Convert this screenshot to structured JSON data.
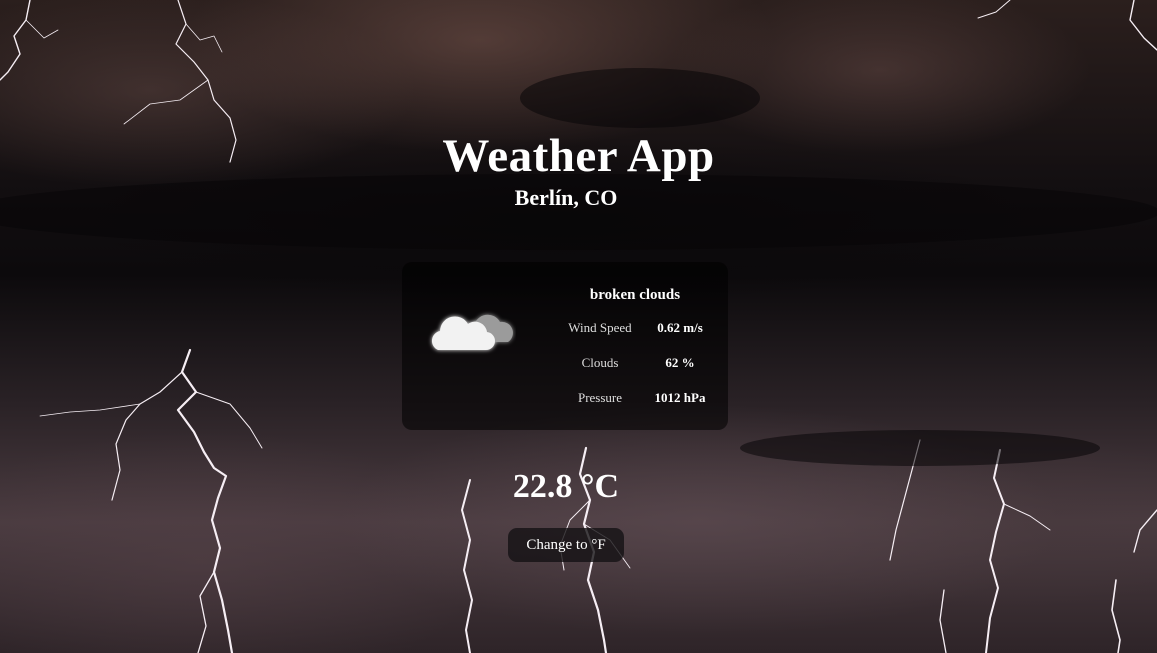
{
  "app": {
    "title": "Weather App",
    "location": "Berlín, CO"
  },
  "current": {
    "description": "broken clouds",
    "icon": "broken-clouds-icon",
    "stats": [
      {
        "label": "Wind Speed",
        "value": "0.62 m/s"
      },
      {
        "label": "Clouds",
        "value": "62 %"
      },
      {
        "label": "Pressure",
        "value": "1012 hPa"
      }
    ],
    "temperature": "22.8 °C"
  },
  "controls": {
    "unit_toggle_label": "Change to °F"
  },
  "background": {
    "scene": "stormy night sky with lightning",
    "sky_color": "#1a1416",
    "lightning_color": "#f4ecf2"
  }
}
